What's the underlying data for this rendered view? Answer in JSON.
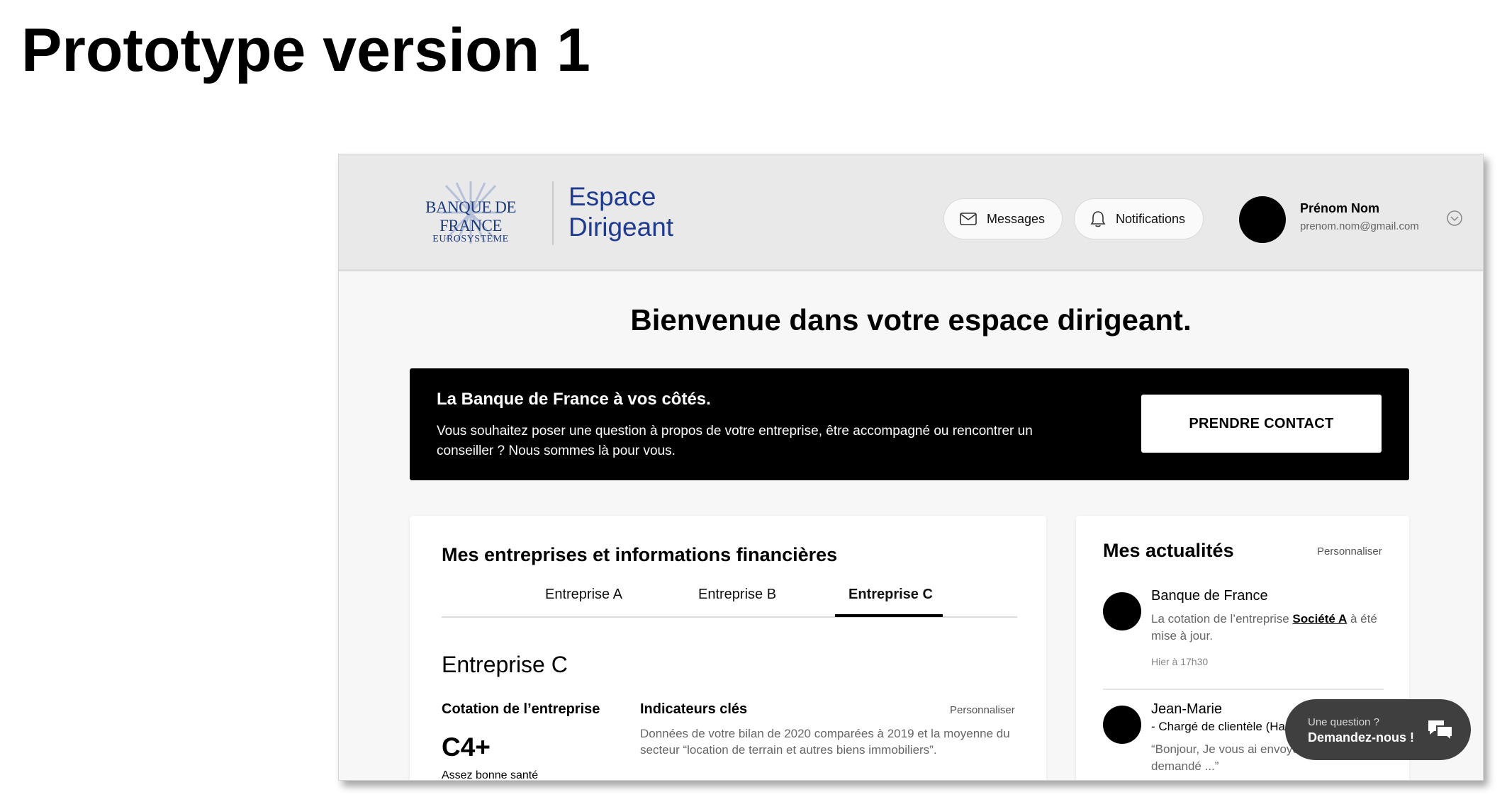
{
  "slide": {
    "title": "Prototype version 1"
  },
  "header": {
    "logo_name": "BANQUE DE FRANCE",
    "logo_sub": "EUROSYSTÈME",
    "app_name_line1": "Espace",
    "app_name_line2": "Dirigeant",
    "messages_label": "Messages",
    "notifications_label": "Notifications",
    "user_name": "Prénom Nom",
    "user_email": "prenom.nom@gmail.com"
  },
  "welcome": "Bienvenue dans votre espace dirigeant.",
  "banner": {
    "title": "La Banque de France à vos côtés.",
    "text": "Vous souhaitez poser une question à propos de votre entreprise, être accompagné ou rencontrer un conseiller ? Nous sommes là pour vous.",
    "button": "PRENDRE CONTACT"
  },
  "companies": {
    "title": "Mes entreprises et informations financières",
    "tabs": [
      "Entreprise A",
      "Entreprise B",
      "Entreprise C"
    ],
    "active_tab": "Entreprise C",
    "company_name": "Entreprise C",
    "cotation_label": "Cotation de l’entreprise",
    "cotation_value": "C4+",
    "cotation_desc": "Assez bonne santé",
    "indicators_label": "Indicateurs clés",
    "indicators_customize": "Personnaliser",
    "indicators_desc": "Données de votre bilan de 2020 comparées à 2019 et la moyenne du secteur “location de terrain et autres biens immobiliers”."
  },
  "news": {
    "title": "Mes actualités",
    "customize": "Personnaliser",
    "items": [
      {
        "author": "Banque de France",
        "text_before": "La cotation de l’entreprise ",
        "link": "Société A",
        "text_after": " à été mise à jour.",
        "time": "Hier à 17h30"
      },
      {
        "author": "Jean-Marie",
        "role": "- Chargé de clientèle (Ha",
        "text": "“Bonjour, Je vous ai envoyé le document demandé ...”"
      }
    ]
  },
  "chat": {
    "question": "Une question ?",
    "cta": "Demandez-nous !"
  }
}
